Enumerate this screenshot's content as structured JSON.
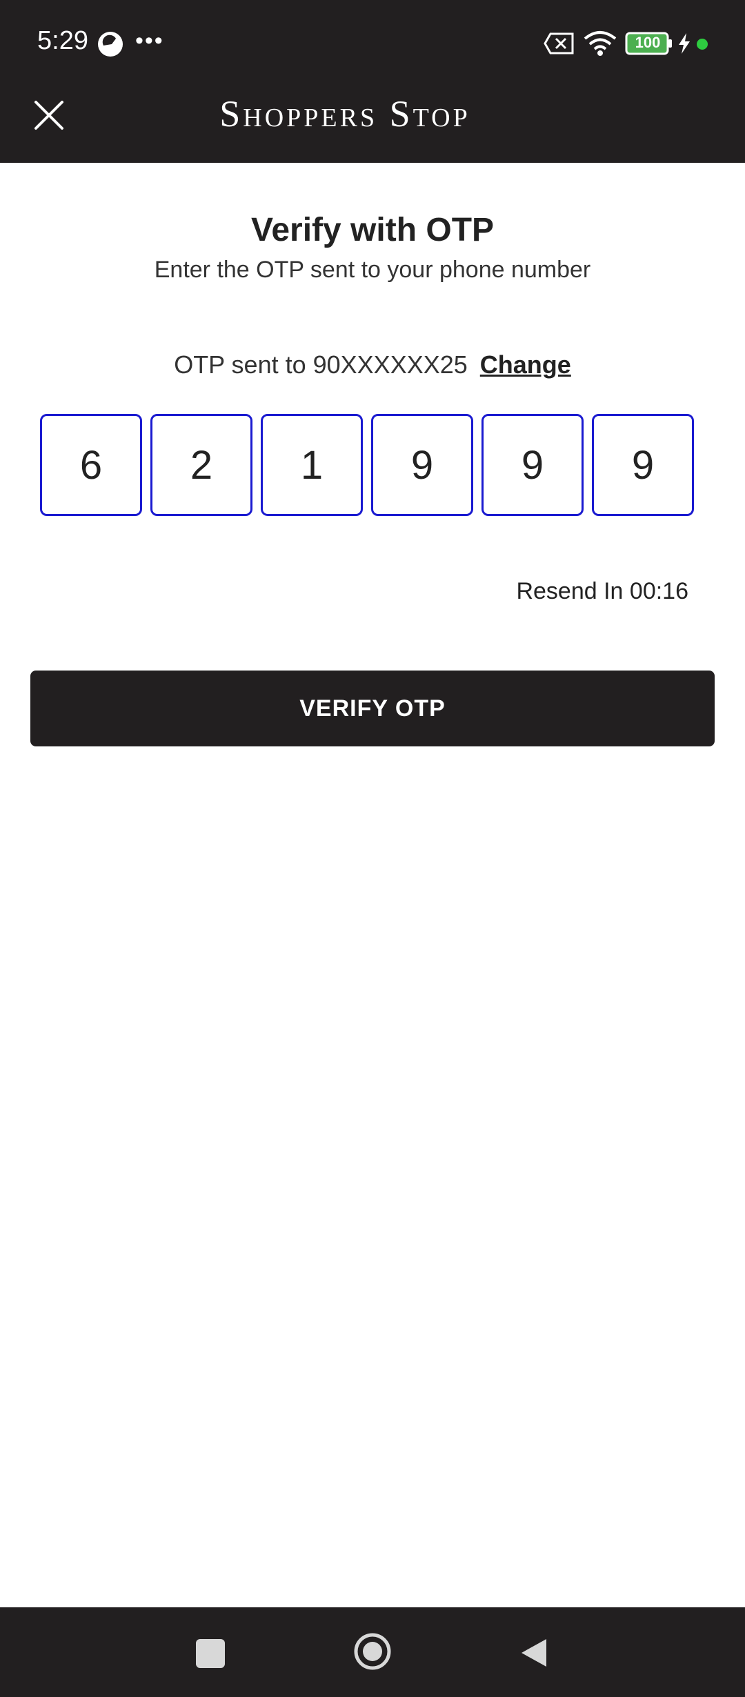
{
  "status_bar": {
    "time": "5:29",
    "battery": "100",
    "icons": [
      "app-status-icon",
      "more-icon",
      "sim-icon",
      "wifi-icon",
      "battery-icon",
      "charge-icon",
      "dot-icon"
    ]
  },
  "header": {
    "brand": "Shoppers Stop",
    "close_icon": "close-icon"
  },
  "content": {
    "title": "Verify with OTP",
    "subtitle": "Enter the OTP sent to your phone number",
    "sent_text": "OTP sent to 90XXXXXX25",
    "change_label": "Change",
    "otp_digits": [
      "6",
      "2",
      "1",
      "9",
      "9",
      "9"
    ],
    "resend_text": "Resend In 00:16",
    "verify_label": "VERIFY OTP"
  },
  "colors": {
    "dark": "#221f20",
    "otp_border": "#1a1ad0",
    "battery_green": "#4caf50",
    "status_dot": "#2ecc40"
  },
  "nav_bar": {
    "icons": [
      "recents-icon",
      "home-icon",
      "back-icon"
    ]
  }
}
